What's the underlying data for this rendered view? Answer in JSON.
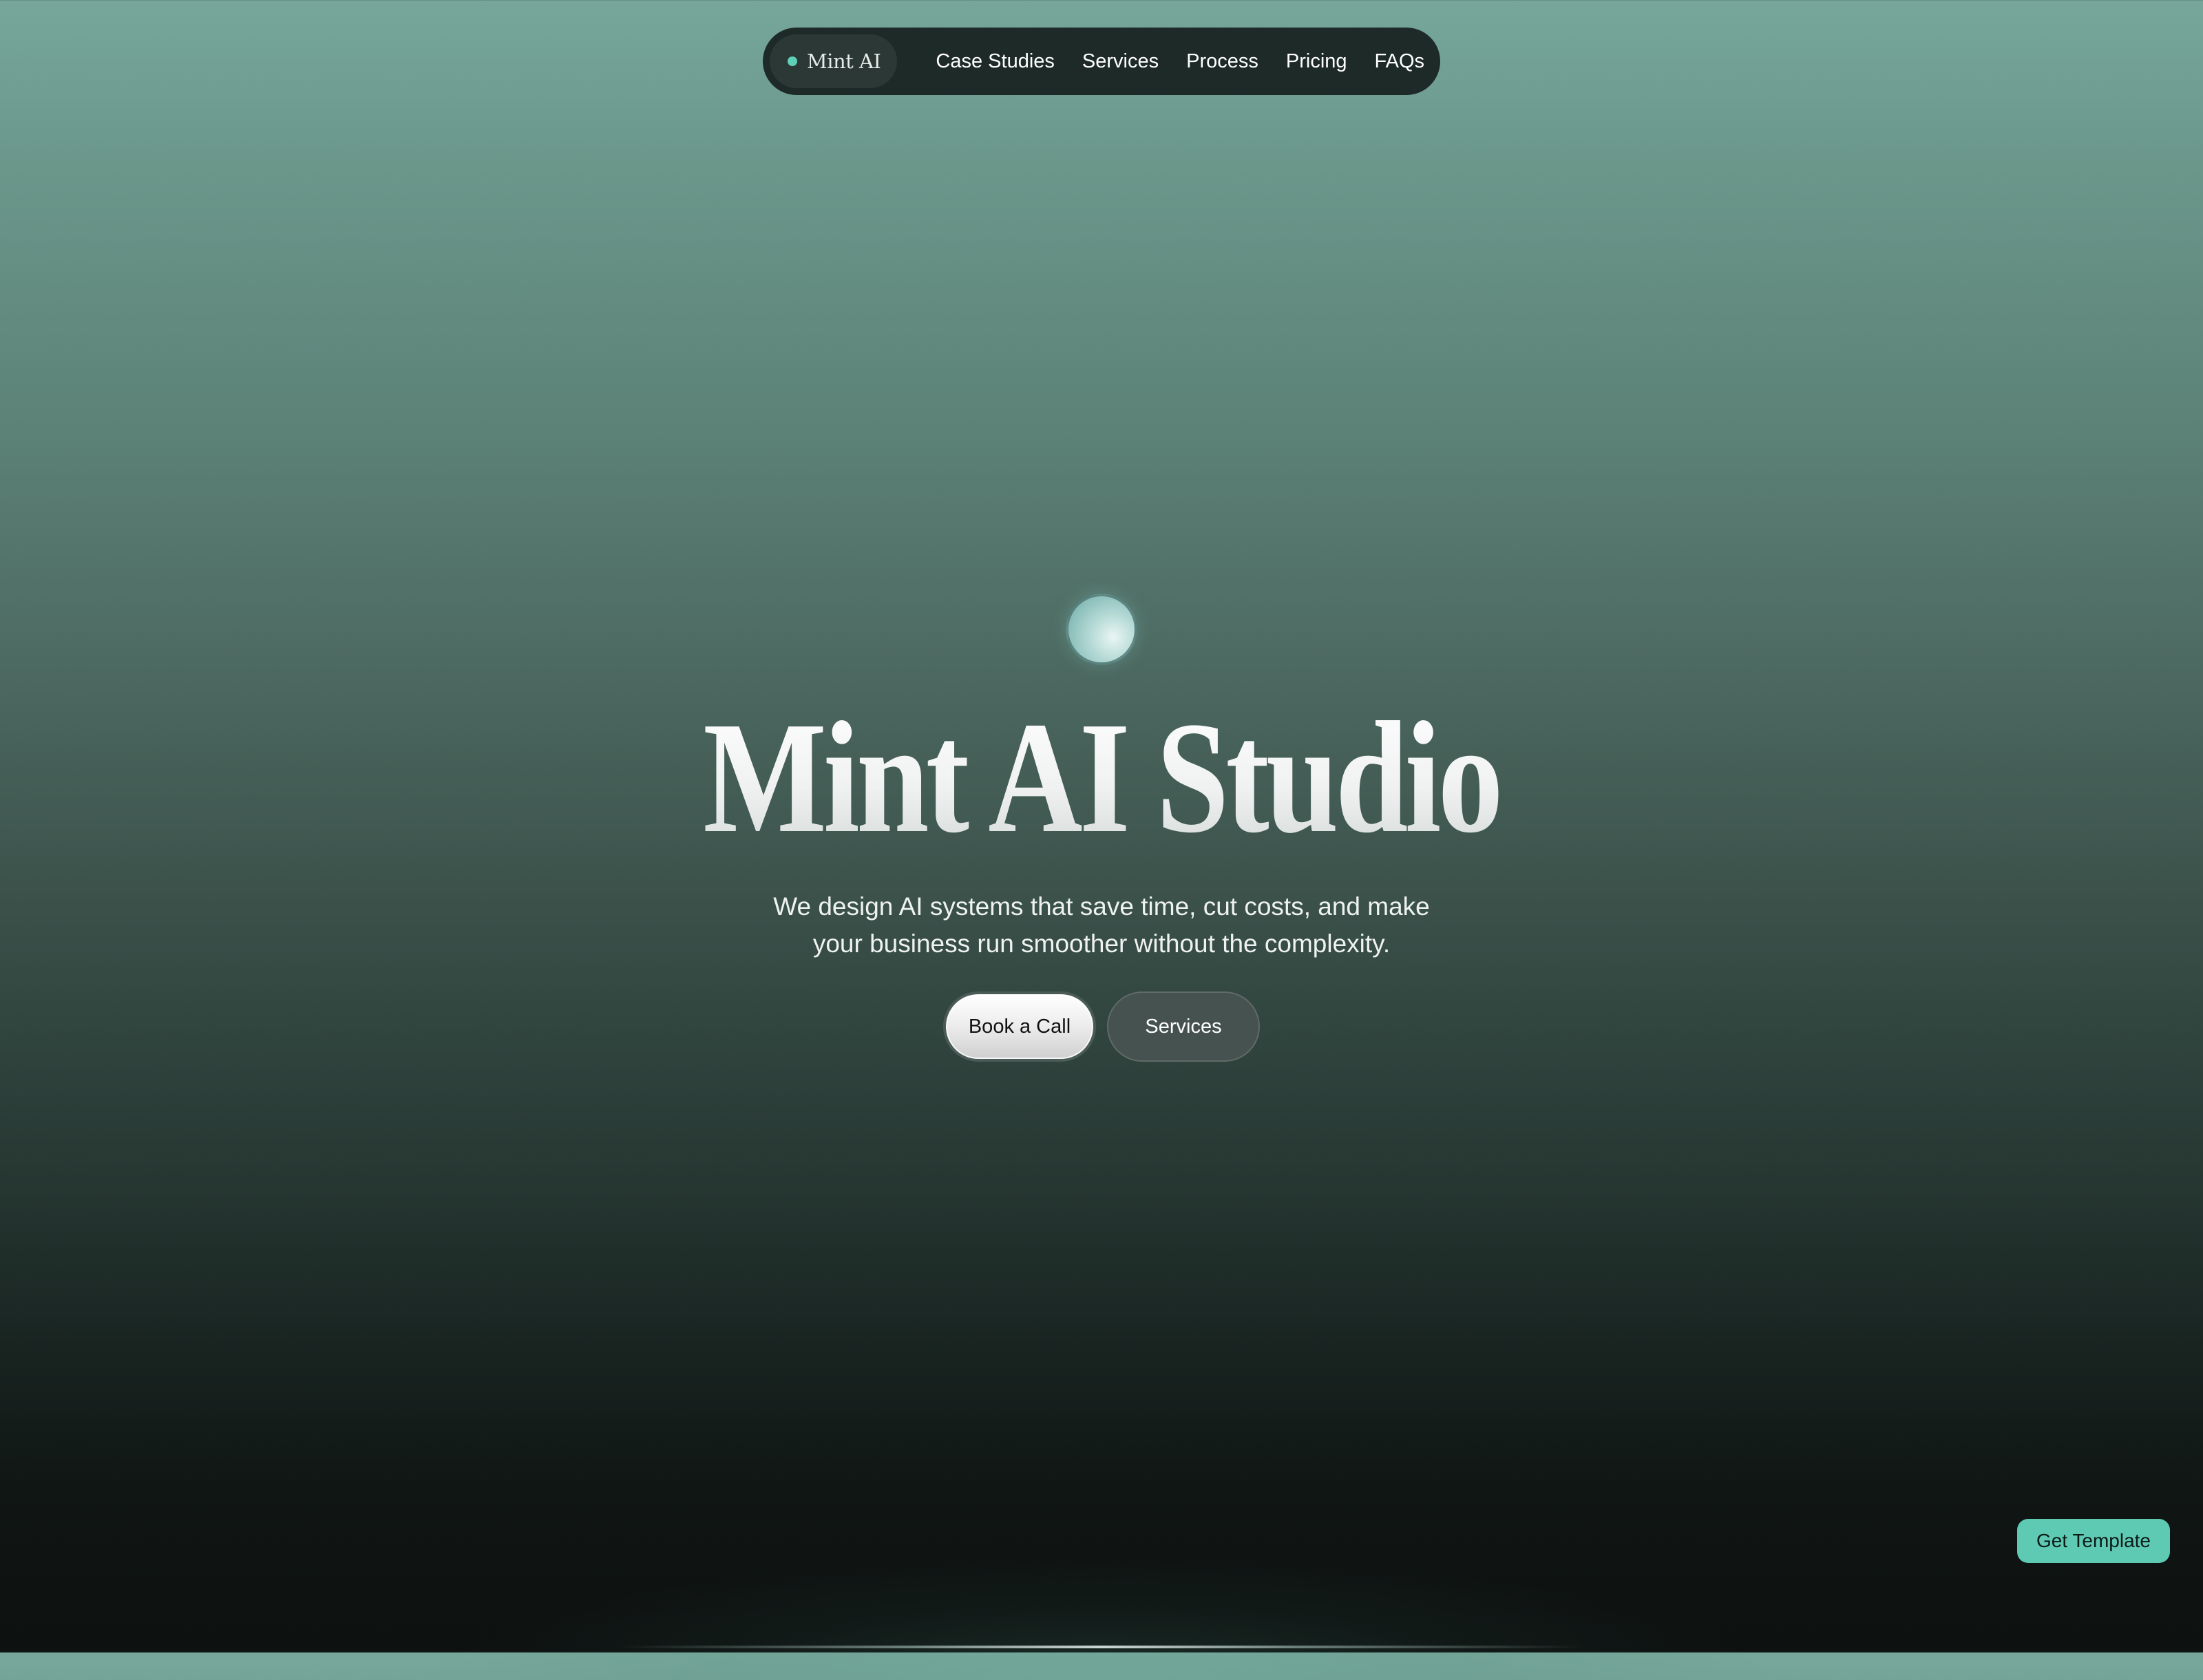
{
  "nav": {
    "brand": "Mint AI",
    "links": [
      "Case Studies",
      "Services",
      "Process",
      "Pricing",
      "FAQs"
    ]
  },
  "hero": {
    "title": "Mint AI Studio",
    "subtitle_line1": "We design AI systems that save time, cut costs, and make",
    "subtitle_line2": "your business run smoother without the complexity.",
    "primary_button": "Book a Call",
    "secondary_button": "Services"
  },
  "floating": {
    "get_template": "Get Template"
  },
  "colors": {
    "accent": "#5ecab4",
    "nav_background": "#1e2a27",
    "background_top": "#76a79a",
    "background_bottom": "#0d1110"
  }
}
